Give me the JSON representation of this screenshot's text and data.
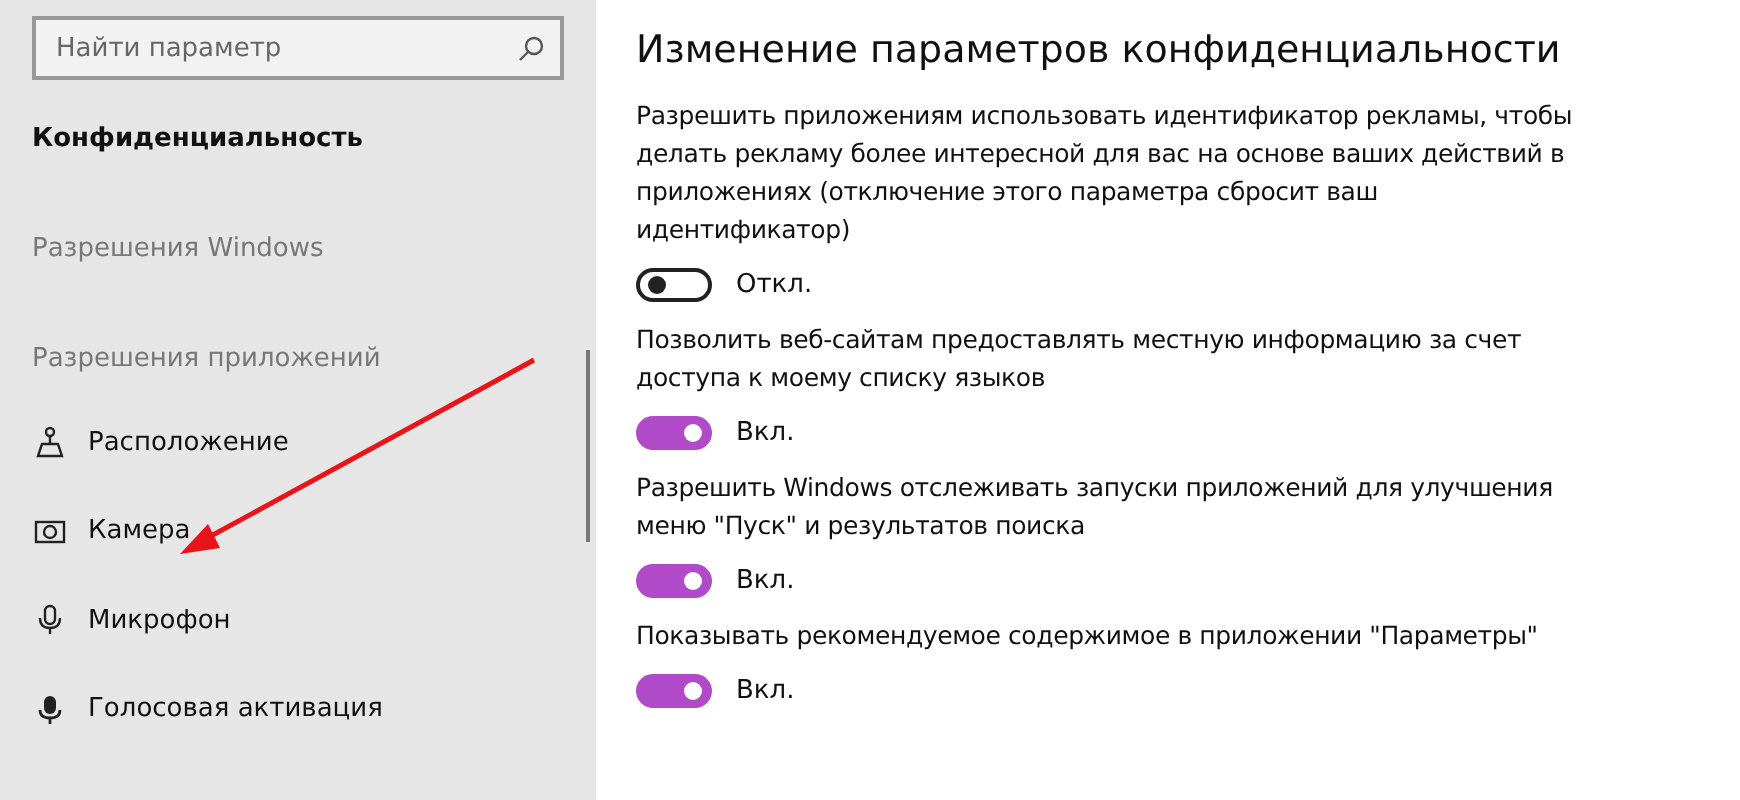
{
  "sidebar": {
    "search": {
      "placeholder": "Найти параметр"
    },
    "section_title": "Конфиденциальность",
    "groups": [
      {
        "heading": "Разрешения Windows"
      },
      {
        "heading": "Разрешения приложений",
        "items": [
          {
            "label": "Расположение",
            "kind": "location"
          },
          {
            "label": "Камера",
            "kind": "camera"
          },
          {
            "label": "Микрофон",
            "kind": "microphone"
          },
          {
            "label": "Голосовая активация",
            "kind": "voice"
          }
        ]
      }
    ]
  },
  "main": {
    "title": "Изменение параметров конфиденциальности",
    "settings": [
      {
        "description": "Разрешить приложениям использовать идентификатор рекламы, чтобы делать рекламу более интересной для вас на основе ваших действий в приложениях (отключение этого параметра сбросит ваш идентификатор)",
        "on": false,
        "state_label": "Откл."
      },
      {
        "description": "Позволить веб-сайтам предоставлять местную информацию за счет доступа к моему списку языков",
        "on": true,
        "state_label": "Вкл."
      },
      {
        "description": "Разрешить Windows отслеживать запуски приложений для улучшения меню \"Пуск\" и результатов поиска",
        "on": true,
        "state_label": "Вкл."
      },
      {
        "description": "Показывать рекомендуемое содержимое в приложении \"Параметры\"",
        "on": true,
        "state_label": "Вкл."
      }
    ]
  }
}
